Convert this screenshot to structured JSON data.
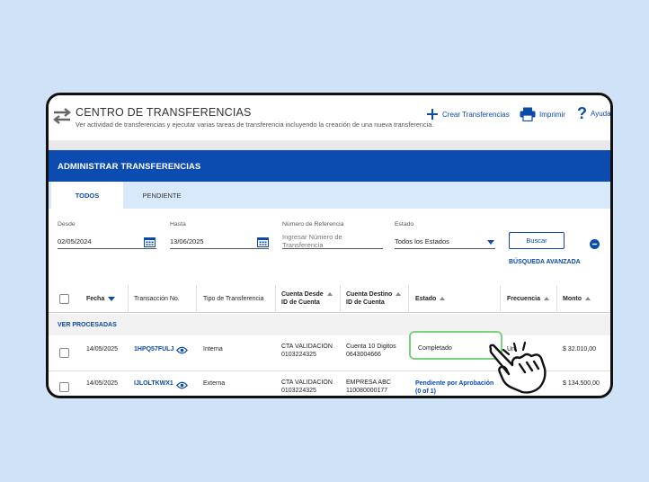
{
  "header": {
    "title": "CENTRO DE TRANSFERENCIAS",
    "subtitle": "Ver actividad de transferencias y ejecutar varias tareas de transferencia incluyendo la creación de una nueva transferencia.",
    "actions": {
      "create": "Crear Transferencias",
      "print": "Imprimir",
      "help": "Ayuda"
    }
  },
  "admin": {
    "title": "ADMINISTRAR TRANSFERENCIAS"
  },
  "tabs": [
    {
      "label": "TODOS",
      "active": true
    },
    {
      "label": "PENDIENTE",
      "active": false
    }
  ],
  "filters": {
    "desde": {
      "label": "Desde",
      "value": "02/05/2024"
    },
    "hasta": {
      "label": "Hasta",
      "value": "13/06/2025"
    },
    "referencia": {
      "label": "Número de Referencia",
      "placeholder": "Ingresar Número de Transferencia"
    },
    "estado": {
      "label": "Estado",
      "value": "Todos los Estados"
    },
    "buscar": "Buscar",
    "busqueda_avanzada": "BÚSQUEDA AVANZADA"
  },
  "table": {
    "headers": {
      "fecha": "Fecha",
      "transaccion": "Transacción No.",
      "tipo": "Tipo de Transferencia",
      "desde_1": "Cuenta Desde",
      "desde_2": "ID de Cuenta",
      "destino_1": "Cuenta Destino",
      "destino_2": "ID de Cuenta",
      "estado": "Estado",
      "frecuencia": "Frecuencia",
      "monto": "Monto"
    },
    "section": "VER PROCESADAS",
    "rows": [
      {
        "fecha": "14/05/2025",
        "transaccion": "1HPQ57FULJ",
        "tipo": "Interna",
        "desde_nombre": "CTA VALIDACION",
        "desde_id": "0103224325",
        "destino_nombre": "Cuenta 10 Digitos",
        "destino_id": "0643004666",
        "estado": "Completado",
        "frecuencia": "Un",
        "monto": "$ 32.010,00"
      },
      {
        "fecha": "14/05/2025",
        "transaccion": "IJLOLTKWX1",
        "tipo": "Externa",
        "desde_nombre": "CTA VALIDACION",
        "desde_id": "0103224325",
        "destino_nombre": "EMPRESA ABC",
        "destino_id": "110080000177",
        "estado": "Pendiente por Aprobación",
        "estado_extra": "(0 of 1)",
        "monto": "$ 134.500,00"
      }
    ]
  },
  "colors": {
    "primary": "#0c4bb0",
    "tab_background": "#d7e9fb",
    "highlight": "#7dd07d",
    "page_background": "#cfe2f6"
  }
}
